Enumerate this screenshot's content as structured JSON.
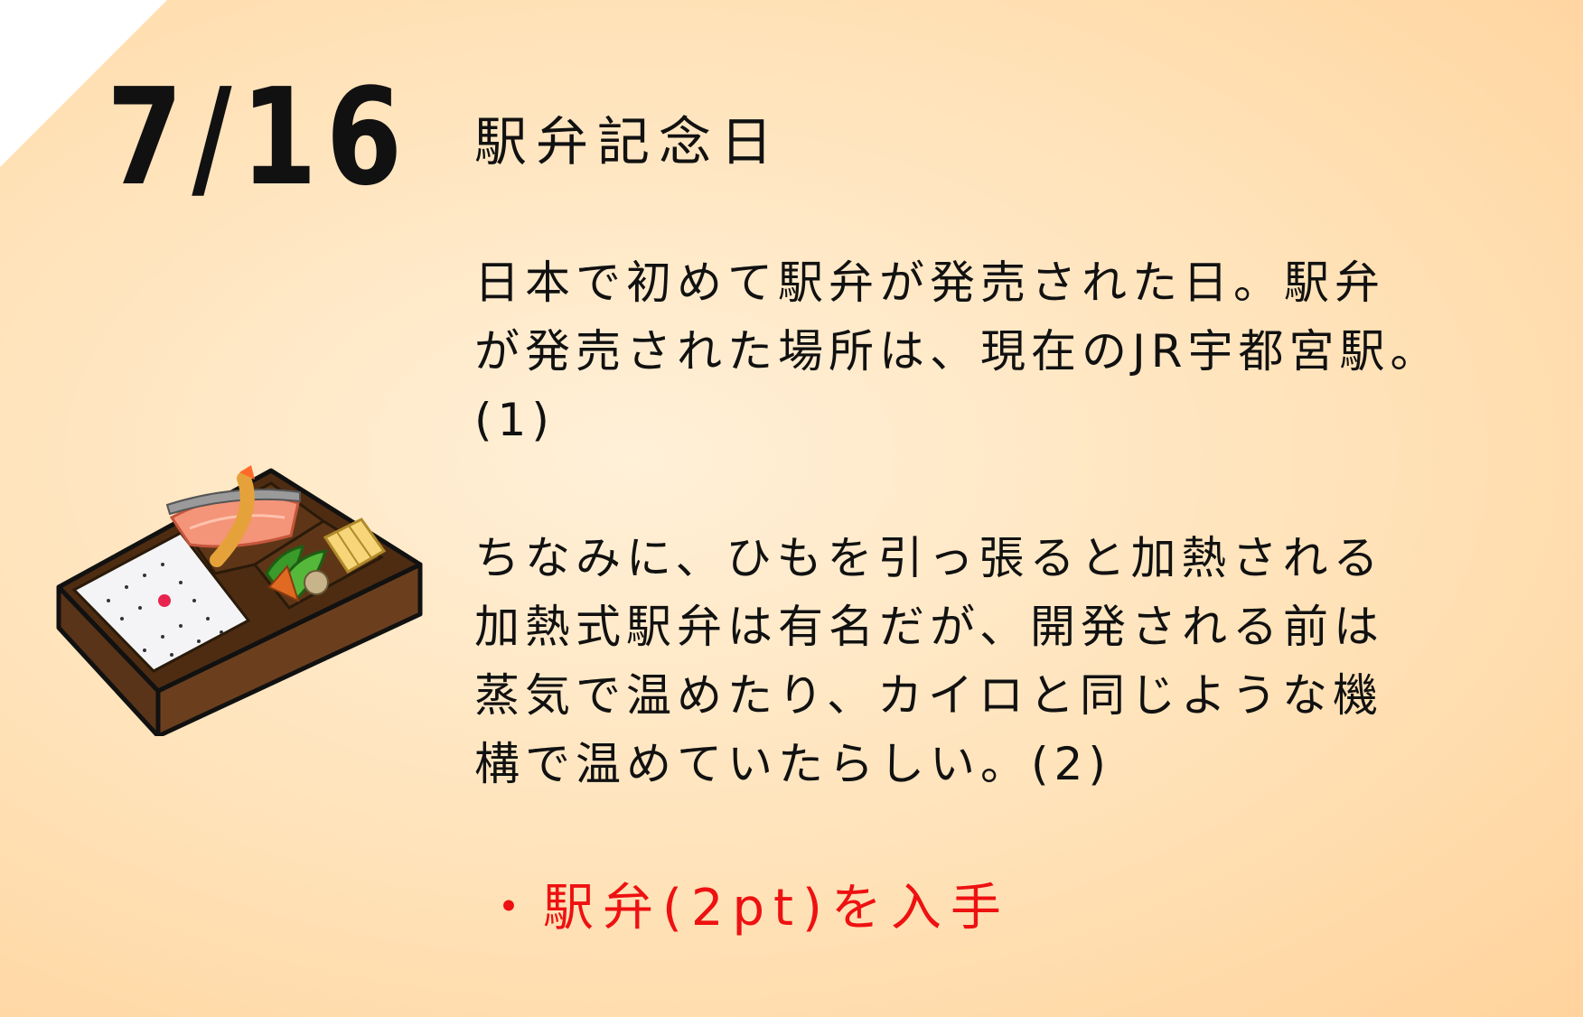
{
  "date": "7/16",
  "title": "駅弁記念日",
  "paragraph1": "日本で初めて駅弁が発売された日。駅弁\nが発売された場所は、現在のJR宇都宮駅。\n(1)",
  "paragraph2": "ちなみに、ひもを引っ張ると加熱される\n加熱式駅弁は有名だが、開発される前は\n蒸気で温めたり、カイロと同じような機\n構で温めていたらしい。(2)",
  "reward": "・駅弁(2pt)を入手",
  "illustration": {
    "icon": "bento-box-icon"
  },
  "colors": {
    "reward": "#ee1111",
    "background": "#ffe2b8"
  }
}
